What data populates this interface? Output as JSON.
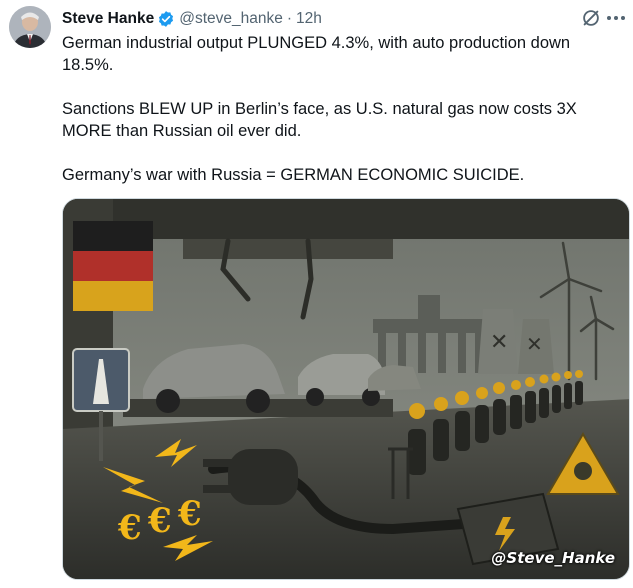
{
  "author": {
    "name": "Steve Hanke",
    "handle": "@steve_hanke",
    "separator": "·",
    "time": "12h",
    "avatar_icon": "user-avatar",
    "verified_icon": "verified-badge-icon",
    "verified_color": "#1d9bf0"
  },
  "actions": {
    "grok_icon": "grok-icon",
    "more_icon": "more-options-icon"
  },
  "tweet": {
    "lines": [
      "German industrial output PLUNGED 4.3%, with auto production down 18.5%.",
      "Sanctions BLEW UP in Berlin’s face, as U.S. natural gas now costs 3X MORE than Russian oil ever did.",
      "Germany’s war with Russia = GERMAN ECONOMIC SUICIDE."
    ]
  },
  "media": {
    "watermark": "@Steve_Hanke",
    "euro_symbols": "€€€",
    "colors": {
      "flag_black": "#1e1e1e",
      "flag_red": "#b0302a",
      "flag_gold": "#d8a31c",
      "spark": "#f2b71a"
    }
  }
}
